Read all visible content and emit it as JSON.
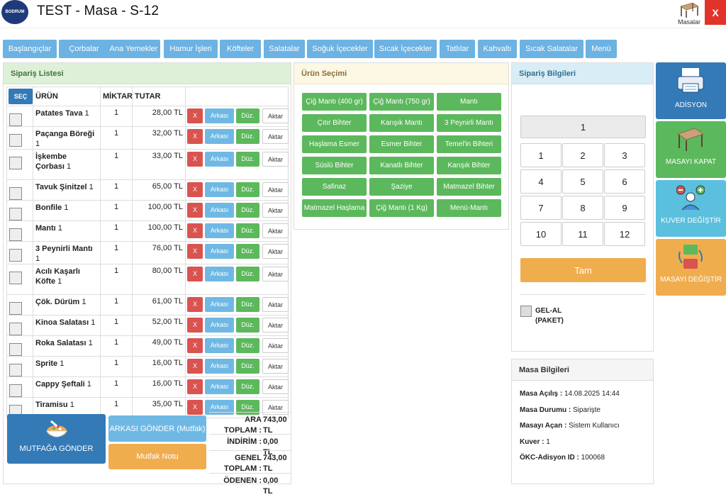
{
  "header": {
    "logo_text": "BODRUM",
    "title": "TEST - Masa - S-12",
    "masalar_label": "Masalar",
    "close_label": "X"
  },
  "categories": [
    "Başlangıçlar",
    "Çorbalar",
    "Ana Yemekler",
    "Hamur İşleri",
    "Köfteler",
    "Salatalar",
    "Soğuk İçecekler",
    "Sıcak İçecekler",
    "Tatlılar",
    "Kahvaltı",
    "Sıcak Salatalar",
    "Menü"
  ],
  "order_list": {
    "title": "Sipariş Listesi",
    "select_btn": "SEÇ",
    "columns": [
      "ÜRÜN",
      "MİKTAR",
      "TUTAR"
    ],
    "actions": {
      "delete": "X",
      "arkasi": "Arkası",
      "duz": "Düz.",
      "aktar": "Aktar"
    },
    "rows": [
      {
        "name": "Patates Tava",
        "qty": "1",
        "miktar": "1",
        "tutar": "28,00 TL"
      },
      {
        "name": "Paçanga Böreği",
        "qty": "1",
        "miktar": "1",
        "tutar": "32,00 TL"
      },
      {
        "name": "İşkembe Çorbası",
        "qty": "1",
        "miktar": "1",
        "tutar": "33,00 TL"
      },
      {
        "name": "Tavuk Şinitzel",
        "qty": "1",
        "miktar": "1",
        "tutar": "65,00 TL"
      },
      {
        "name": "Bonfile",
        "qty": "1",
        "miktar": "1",
        "tutar": "100,00 TL"
      },
      {
        "name": "Mantı",
        "qty": "1",
        "miktar": "1",
        "tutar": "100,00 TL"
      },
      {
        "name": "3 Peynirli Mantı",
        "qty": "1",
        "miktar": "1",
        "tutar": "76,00 TL"
      },
      {
        "name": "Acılı Kaşarlı Köfte",
        "qty": "1",
        "miktar": "1",
        "tutar": "80,00 TL"
      },
      {
        "name": "Çök. Dürüm",
        "qty": "1",
        "miktar": "1",
        "tutar": "61,00 TL"
      },
      {
        "name": "Kinoa Salatası",
        "qty": "1",
        "miktar": "1",
        "tutar": "52,00 TL"
      },
      {
        "name": "Roka Salatası",
        "qty": "1",
        "miktar": "1",
        "tutar": "49,00 TL"
      },
      {
        "name": "Sprite",
        "qty": "1",
        "miktar": "1",
        "tutar": "16,00 TL"
      },
      {
        "name": "Cappy Şeftali",
        "qty": "1",
        "miktar": "1",
        "tutar": "16,00 TL"
      },
      {
        "name": "Tiramisu",
        "qty": "1",
        "miktar": "1",
        "tutar": "35,00 TL"
      }
    ],
    "mutfaga_gonder": "MUTFAĞA GÖNDER",
    "arkasi_gonder": "ARKASI GÖNDER (Mutfak)",
    "mutfak_notu": "Mutfak Notu",
    "totals": [
      {
        "label": "ARA TOPLAM :",
        "value": "743,00 TL"
      },
      {
        "label": "İNDİRİM :",
        "value": "0,00 TL"
      },
      {
        "label": "GENEL TOPLAM :",
        "value": "743,00 TL"
      },
      {
        "label": "ÖDENEN :",
        "value": "0,00 TL"
      }
    ]
  },
  "product_select": {
    "title": "Ürün Seçimi",
    "items": [
      "Çiğ Mantı (400 gr)",
      "Çiğ Mantı (750 gr)",
      "Mantı",
      "Çıtır Bihter",
      "Karışık Mantı",
      "3 Peynirli Mantı",
      "Haşlama Esmer",
      "Esmer Bihter",
      "Temel'in Bihteri",
      "Süslü Bihter",
      "Kanatlı Bihter",
      "Karışık Bihter",
      "Safinaz",
      "Şaziye",
      "Matmazel Bihter",
      "Matmazel Haşlama",
      "Çiğ Mantı (1 Kg)",
      "Menü-Mantı"
    ]
  },
  "order_info": {
    "title": "Sipariş Bilgileri",
    "display": "1",
    "keys": [
      "1",
      "2",
      "3",
      "4",
      "5",
      "6",
      "7",
      "8",
      "9",
      "10",
      "11",
      "12"
    ],
    "tam": "Tam",
    "gel_al": "GEL-AL (PAKET)"
  },
  "table_info": {
    "title": "Masa Bilgileri",
    "rows": [
      {
        "label": "Masa Açılış :",
        "value": "14.08.2025 14:44"
      },
      {
        "label": "Masa Durumu :",
        "value": "Siparişte"
      },
      {
        "label": "Masayı Açan :",
        "value": "Sistem Kullanıcı"
      },
      {
        "label": "Kuver :",
        "value": "1"
      },
      {
        "label": "ÖKC-Adisyon ID :",
        "value": "100068"
      }
    ]
  },
  "side_buttons": [
    {
      "label": "ADİSYON",
      "color": "#337ab7"
    },
    {
      "label": "MASAYI KAPAT",
      "color": "#5cb85c"
    },
    {
      "label": "KUVER DEĞİŞTİR",
      "color": "#5bc0de"
    },
    {
      "label": "MASAYI DEĞİŞTİR",
      "color": "#f0ad4e"
    }
  ]
}
